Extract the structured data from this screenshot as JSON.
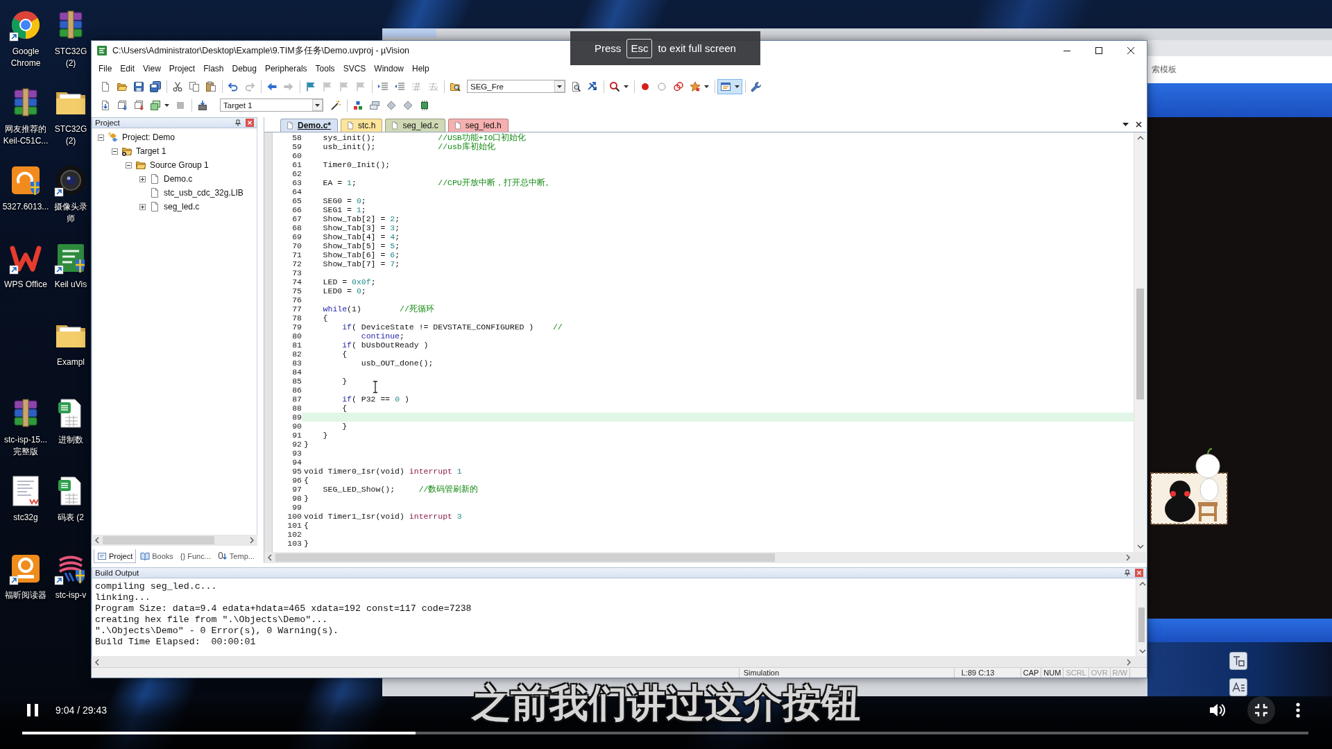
{
  "desktop": {
    "column_1": [
      {
        "kind": "browser",
        "label": "Google Chrome"
      },
      {
        "kind": "archive",
        "label": "网友推荐的Keil-C51C..."
      },
      {
        "kind": "pdf",
        "label": "5327.6013..."
      },
      {
        "kind": "wps",
        "label": "WPS Office"
      },
      {
        "kind": "archive",
        "label": "stc-isp-15... 完整版"
      },
      {
        "kind": "document",
        "label": "stc32g"
      },
      {
        "kind": "reader",
        "label": "福昕阅读器"
      }
    ],
    "column_2": [
      {
        "kind": "archive",
        "label": "STC32G (2)"
      },
      {
        "kind": "folder",
        "label": "STC32G (2)"
      },
      {
        "kind": "camera",
        "label": "摄像头录师"
      },
      {
        "kind": "keil",
        "label": "Keil uVis"
      },
      {
        "kind": "folder",
        "label": "Exampl"
      },
      {
        "kind": "spreadsheet",
        "label": "进制数"
      },
      {
        "kind": "spreadsheet",
        "label": "码表 (2"
      },
      {
        "kind": "isp",
        "label": "stc-isp-v"
      }
    ]
  },
  "background_window": {
    "visible_text": "索模板"
  },
  "uvision": {
    "title": "C:\\Users\\Administrator\\Desktop\\Example\\9.TIM多任务\\Demo.uvproj - µVision",
    "menu": [
      "File",
      "Edit",
      "View",
      "Project",
      "Flash",
      "Debug",
      "Peripherals",
      "Tools",
      "SVCS",
      "Window",
      "Help"
    ],
    "toolbar_1": {
      "items": [
        {
          "kind": "button",
          "disabled": false,
          "pressed": false
        },
        {
          "kind": "button",
          "disabled": false,
          "pressed": false
        },
        {
          "kind": "button",
          "disabled": false,
          "pressed": false
        },
        {
          "kind": "button",
          "disabled": false,
          "pressed": false
        },
        {
          "kind": "separator"
        },
        {
          "kind": "button",
          "disabled": false,
          "pressed": false
        },
        {
          "kind": "button",
          "disabled": false,
          "pressed": false
        },
        {
          "kind": "button",
          "disabled": false,
          "pressed": false
        },
        {
          "kind": "separator"
        },
        {
          "kind": "button",
          "disabled": false,
          "pressed": false
        },
        {
          "kind": "button",
          "disabled": true,
          "pressed": false
        },
        {
          "kind": "separator"
        },
        {
          "kind": "button",
          "disabled": false,
          "pressed": false
        },
        {
          "kind": "button",
          "disabled": true,
          "pressed": false
        },
        {
          "kind": "separator"
        },
        {
          "kind": "button",
          "disabled": false,
          "pressed": false
        },
        {
          "kind": "button",
          "disabled": true,
          "pressed": false
        },
        {
          "kind": "button",
          "disabled": true,
          "pressed": false
        },
        {
          "kind": "button",
          "disabled": true,
          "pressed": false
        },
        {
          "kind": "separator"
        },
        {
          "kind": "button",
          "disabled": false,
          "pressed": false
        },
        {
          "kind": "button",
          "disabled": false,
          "pressed": false
        },
        {
          "kind": "button",
          "disabled": true,
          "pressed": false
        },
        {
          "kind": "button",
          "disabled": true,
          "pressed": false
        },
        {
          "kind": "separator"
        },
        {
          "kind": "button",
          "disabled": false,
          "pressed": false
        },
        {
          "kind": "combo",
          "value": "SEG_Fre"
        },
        {
          "kind": "button",
          "disabled": false,
          "pressed": false
        },
        {
          "kind": "button",
          "disabled": false,
          "pressed": false
        },
        {
          "kind": "separator"
        },
        {
          "kind": "menu_button",
          "disabled": false,
          "pressed": false
        },
        {
          "kind": "separator"
        },
        {
          "kind": "button",
          "disabled": false,
          "pressed": false
        },
        {
          "kind": "button",
          "disabled": false,
          "pressed": false
        },
        {
          "kind": "button",
          "disabled": false,
          "pressed": false
        },
        {
          "kind": "menu_button",
          "disabled": false,
          "pressed": false
        },
        {
          "kind": "separator"
        },
        {
          "kind": "menu_button",
          "disabled": false,
          "pressed": true
        },
        {
          "kind": "separator"
        },
        {
          "kind": "button",
          "disabled": false,
          "pressed": false
        }
      ]
    },
    "toolbar_2": {
      "items": [
        {
          "kind": "button",
          "disabled": false,
          "pressed": false
        },
        {
          "kind": "button",
          "disabled": false,
          "pressed": false
        },
        {
          "kind": "button",
          "disabled": false,
          "pressed": false
        },
        {
          "kind": "menu_button",
          "disabled": false,
          "pressed": false
        },
        {
          "kind": "button",
          "disabled": true,
          "pressed": false
        },
        {
          "kind": "separator"
        },
        {
          "kind": "button",
          "disabled": false,
          "pressed": false
        },
        {
          "kind": "combo",
          "value": "Target 1"
        },
        {
          "kind": "button",
          "disabled": false,
          "pressed": false
        },
        {
          "kind": "separator"
        },
        {
          "kind": "button",
          "disabled": false,
          "pressed": false
        },
        {
          "kind": "button",
          "disabled": false,
          "pressed": false
        },
        {
          "kind": "button",
          "disabled": false,
          "pressed": false
        },
        {
          "kind": "button",
          "disabled": false,
          "pressed": false
        },
        {
          "kind": "button",
          "disabled": false,
          "pressed": false
        }
      ]
    },
    "project_panel": {
      "title": "Project",
      "tree": [
        {
          "kind": "project",
          "label": "Project: Demo",
          "expanded": true,
          "children": [
            {
              "kind": "target",
              "label": "Target 1",
              "expanded": true,
              "children": [
                {
                  "kind": "group",
                  "label": "Source Group 1",
                  "expanded": true,
                  "children": [
                    {
                      "kind": "file",
                      "label": "Demo.c",
                      "expanded": false
                    },
                    {
                      "kind": "file",
                      "label": "stc_usb_cdc_32g.LIB"
                    },
                    {
                      "kind": "file",
                      "label": "seg_led.c",
                      "expanded": false
                    }
                  ]
                }
              ]
            }
          ]
        }
      ],
      "tabs": [
        {
          "label": "Project",
          "selected": true
        },
        {
          "label": "Books",
          "selected": false
        },
        {
          "label": "{} Func...",
          "selected": false
        },
        {
          "label": "Temp...",
          "selected": false
        }
      ]
    },
    "editor": {
      "tabs": [
        {
          "label": "Demo.c*",
          "selected": true,
          "color": "#d5e2f4"
        },
        {
          "label": "stc.h",
          "selected": false,
          "color": "#fce49b"
        },
        {
          "label": "seg_led.c",
          "selected": false,
          "color": "#cfd9b5"
        },
        {
          "label": "seg_led.h",
          "selected": false,
          "color": "#f6b0b0"
        }
      ],
      "lines": [
        {
          "number": "58",
          "current": false,
          "tokens": [
            {
              "kind": "plain",
              "text": "    sys_init();             "
            },
            {
              "kind": "comment",
              "text": "//USB功能+IO口初始化"
            }
          ]
        },
        {
          "number": "59",
          "current": false,
          "tokens": [
            {
              "kind": "plain",
              "text": "    usb_init();             "
            },
            {
              "kind": "comment",
              "text": "//usb库初始化"
            }
          ]
        },
        {
          "number": "60",
          "current": false
        },
        {
          "number": "61",
          "current": false,
          "tokens": [
            {
              "kind": "plain",
              "text": "    Timer0_Init();"
            }
          ]
        },
        {
          "number": "62",
          "current": false
        },
        {
          "number": "63",
          "current": false,
          "tokens": [
            {
              "kind": "plain",
              "text": "    EA = "
            },
            {
              "kind": "number",
              "text": "1"
            },
            {
              "kind": "plain",
              "text": ";                 "
            },
            {
              "kind": "comment",
              "text": "//CPU开放中断，打开总中断。"
            }
          ]
        },
        {
          "number": "64",
          "current": false
        },
        {
          "number": "65",
          "current": false,
          "tokens": [
            {
              "kind": "plain",
              "text": "    SEG0 = "
            },
            {
              "kind": "number",
              "text": "0"
            },
            {
              "kind": "plain",
              "text": ";"
            }
          ]
        },
        {
          "number": "66",
          "current": false,
          "tokens": [
            {
              "kind": "plain",
              "text": "    SEG1 = "
            },
            {
              "kind": "number",
              "text": "1"
            },
            {
              "kind": "plain",
              "text": ";"
            }
          ]
        },
        {
          "number": "67",
          "current": false,
          "tokens": [
            {
              "kind": "plain",
              "text": "    Show_Tab[2] = "
            },
            {
              "kind": "number",
              "text": "2"
            },
            {
              "kind": "plain",
              "text": ";"
            }
          ]
        },
        {
          "number": "68",
          "current": false,
          "tokens": [
            {
              "kind": "plain",
              "text": "    Show_Tab[3] = "
            },
            {
              "kind": "number",
              "text": "3"
            },
            {
              "kind": "plain",
              "text": ";"
            }
          ]
        },
        {
          "number": "69",
          "current": false,
          "tokens": [
            {
              "kind": "plain",
              "text": "    Show_Tab[4] = "
            },
            {
              "kind": "number",
              "text": "4"
            },
            {
              "kind": "plain",
              "text": ";"
            }
          ]
        },
        {
          "number": "70",
          "current": false,
          "tokens": [
            {
              "kind": "plain",
              "text": "    Show_Tab[5] = "
            },
            {
              "kind": "number",
              "text": "5"
            },
            {
              "kind": "plain",
              "text": ";"
            }
          ]
        },
        {
          "number": "71",
          "current": false,
          "tokens": [
            {
              "kind": "plain",
              "text": "    Show_Tab[6] = "
            },
            {
              "kind": "number",
              "text": "6"
            },
            {
              "kind": "plain",
              "text": ";"
            }
          ]
        },
        {
          "number": "72",
          "current": false,
          "tokens": [
            {
              "kind": "plain",
              "text": "    Show_Tab[7] = "
            },
            {
              "kind": "number",
              "text": "7"
            },
            {
              "kind": "plain",
              "text": ";"
            }
          ]
        },
        {
          "number": "73",
          "current": false
        },
        {
          "number": "74",
          "current": false,
          "tokens": [
            {
              "kind": "plain",
              "text": "    LED = "
            },
            {
              "kind": "number",
              "text": "0x0f"
            },
            {
              "kind": "plain",
              "text": ";"
            }
          ]
        },
        {
          "number": "75",
          "current": false,
          "tokens": [
            {
              "kind": "plain",
              "text": "    LED0 = "
            },
            {
              "kind": "number",
              "text": "0"
            },
            {
              "kind": "plain",
              "text": ";"
            }
          ]
        },
        {
          "number": "76",
          "current": false
        },
        {
          "number": "77",
          "current": false,
          "tokens": [
            {
              "kind": "keyword",
              "text": "    while"
            },
            {
              "kind": "plain",
              "text": "(1)        "
            },
            {
              "kind": "comment",
              "text": "//死循环"
            }
          ]
        },
        {
          "number": "78",
          "current": false,
          "tokens": [
            {
              "kind": "plain",
              "text": "    {"
            }
          ]
        },
        {
          "number": "79",
          "current": false,
          "tokens": [
            {
              "kind": "keyword",
              "text": "        if"
            },
            {
              "kind": "plain",
              "text": "( DeviceState != DEVSTATE_CONFIGURED )    "
            },
            {
              "kind": "comment",
              "text": "//"
            }
          ]
        },
        {
          "number": "80",
          "current": false,
          "tokens": [
            {
              "kind": "keyword",
              "text": "            continue"
            },
            {
              "kind": "plain",
              "text": ";"
            }
          ]
        },
        {
          "number": "81",
          "current": false,
          "tokens": [
            {
              "kind": "keyword",
              "text": "        if"
            },
            {
              "kind": "plain",
              "text": "( bUsbOutReady )"
            }
          ]
        },
        {
          "number": "82",
          "current": false,
          "tokens": [
            {
              "kind": "plain",
              "text": "        {"
            }
          ]
        },
        {
          "number": "83",
          "current": false,
          "tokens": [
            {
              "kind": "plain",
              "text": "            usb_OUT_done();"
            }
          ]
        },
        {
          "number": "84",
          "current": false
        },
        {
          "number": "85",
          "current": false,
          "tokens": [
            {
              "kind": "plain",
              "text": "        }"
            }
          ]
        },
        {
          "number": "86",
          "current": false
        },
        {
          "number": "87",
          "current": false,
          "tokens": [
            {
              "kind": "keyword",
              "text": "        if"
            },
            {
              "kind": "plain",
              "text": "( P32 == "
            },
            {
              "kind": "number",
              "text": "0"
            },
            {
              "kind": "plain",
              "text": " )"
            }
          ]
        },
        {
          "number": "88",
          "current": false,
          "tokens": [
            {
              "kind": "plain",
              "text": "        {"
            }
          ]
        },
        {
          "number": "89",
          "current": true
        },
        {
          "number": "90",
          "current": false,
          "tokens": [
            {
              "kind": "plain",
              "text": "        }"
            }
          ]
        },
        {
          "number": "91",
          "current": false,
          "tokens": [
            {
              "kind": "plain",
              "text": "    }"
            }
          ]
        },
        {
          "number": "92",
          "current": false,
          "tokens": [
            {
              "kind": "plain",
              "text": "}"
            }
          ]
        },
        {
          "number": "93",
          "current": false
        },
        {
          "number": "94",
          "current": false
        },
        {
          "number": "95",
          "current": false,
          "tokens": [
            {
              "kind": "plain",
              "text": "void Timer0_Isr(void) "
            },
            {
              "kind": "directive",
              "text": "interrupt"
            },
            {
              "kind": "number",
              "text": " 1"
            }
          ]
        },
        {
          "number": "96",
          "current": false,
          "tokens": [
            {
              "kind": "plain",
              "text": "{"
            }
          ]
        },
        {
          "number": "97",
          "current": false,
          "tokens": [
            {
              "kind": "plain",
              "text": "    SEG_LED_Show();     "
            },
            {
              "kind": "comment",
              "text": "//数码管刷新的"
            }
          ]
        },
        {
          "number": "98",
          "current": false,
          "tokens": [
            {
              "kind": "plain",
              "text": "}"
            }
          ]
        },
        {
          "number": "99",
          "current": false
        },
        {
          "number": "100",
          "current": false,
          "tokens": [
            {
              "kind": "plain",
              "text": "void Timer1_Isr(void) "
            },
            {
              "kind": "directive",
              "text": "interrupt"
            },
            {
              "kind": "number",
              "text": " 3"
            }
          ]
        },
        {
          "number": "101",
          "current": false,
          "tokens": [
            {
              "kind": "plain",
              "text": "{"
            }
          ]
        },
        {
          "number": "102",
          "current": false
        },
        {
          "number": "103",
          "current": false,
          "tokens": [
            {
              "kind": "plain",
              "text": "}"
            }
          ]
        }
      ]
    },
    "build_output": {
      "title": "Build Output",
      "lines": [
        "compiling seg_led.c...",
        "linking...",
        "Program Size: data=9.4 edata+hdata=465 xdata=192 const=117 code=7238",
        "creating hex file from \".\\Objects\\Demo\"...",
        "\".\\Objects\\Demo\" - 0 Error(s), 0 Warning(s).",
        "Build Time Elapsed:  00:00:01"
      ]
    },
    "status_bar": {
      "mode": "Simulation",
      "position": "L:89 C:13",
      "indicators": [
        {
          "label": "CAP",
          "on": true
        },
        {
          "label": "NUM",
          "on": true
        },
        {
          "label": "SCRL",
          "on": false
        },
        {
          "label": "OVR",
          "on": false
        },
        {
          "label": "R/W",
          "on": false
        }
      ]
    }
  },
  "fullscreen_hint": {
    "before": "Press",
    "key": "Esc",
    "after": "to exit full screen"
  },
  "player": {
    "subtitle": "之前我们讲过这介按钮",
    "playing": true,
    "time": "9:04 / 29:43",
    "level": 0.306
  }
}
